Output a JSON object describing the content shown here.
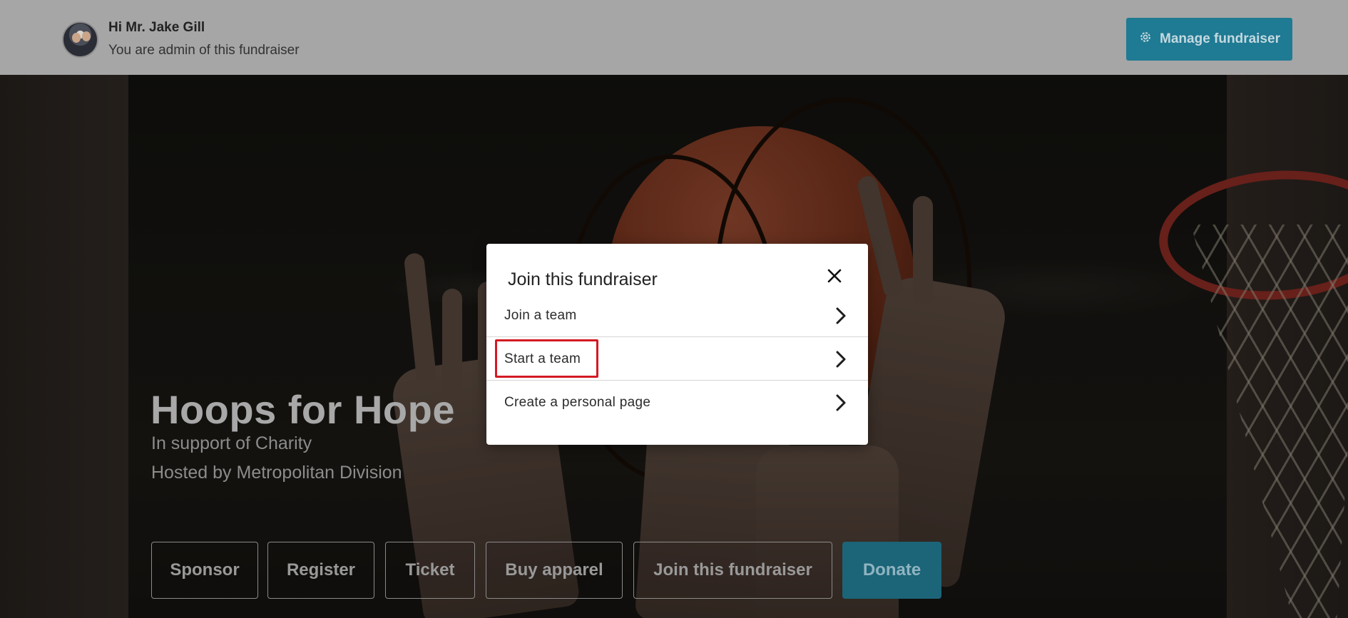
{
  "header": {
    "greeting": "Hi Mr. Jake Gill",
    "role_text": "You are admin of this fundraiser",
    "manage_label": "Manage fundraiser",
    "manage_icon": "gear-icon"
  },
  "hero": {
    "title": "Hoops for Hope",
    "support_text": "In support of Charity",
    "host_text": "Hosted by Metropolitan Division",
    "actions": {
      "sponsor": "Sponsor",
      "register": "Register",
      "ticket": "Ticket",
      "buy_apparel": "Buy apparel",
      "join": "Join this fundraiser",
      "donate": "Donate"
    }
  },
  "modal": {
    "title": "Join this fundraiser",
    "close_icon": "close-icon",
    "options": {
      "join_team": "Join a team",
      "start_team": "Start a team",
      "personal_page": "Create a personal page"
    },
    "chevron_icon": "chevron-right-icon"
  },
  "colors": {
    "header_bg": "#a6a6a6",
    "accent": "#1f7a93",
    "highlight": "#d41a24"
  }
}
